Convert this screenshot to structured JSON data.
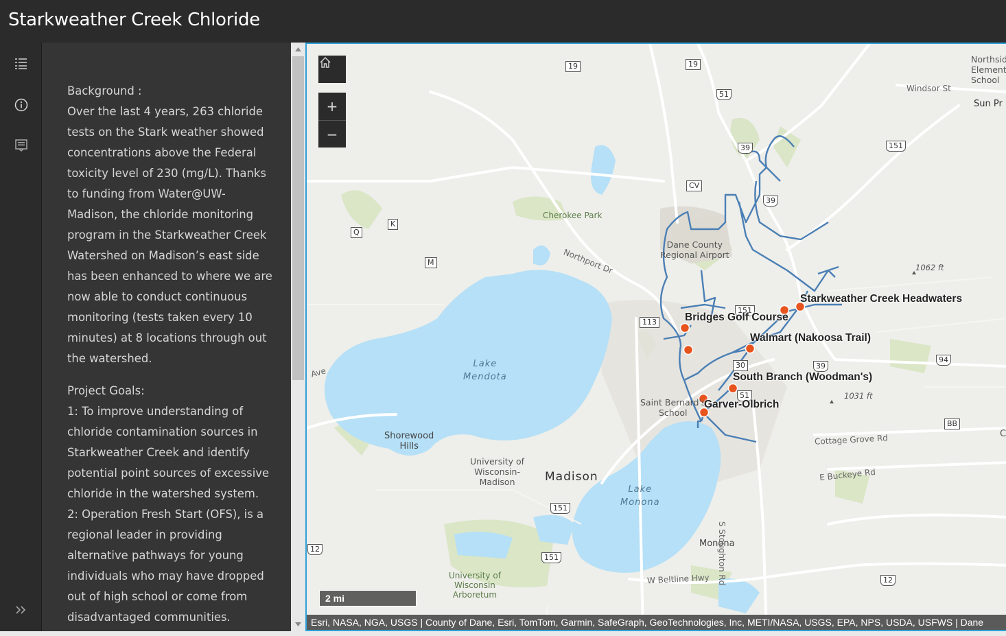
{
  "app": {
    "title": "Starkweather Creek Chloride"
  },
  "rail": {
    "items": [
      {
        "icon": "list-icon",
        "label": "Layer list"
      },
      {
        "icon": "info-icon",
        "label": "About"
      },
      {
        "icon": "legend-icon",
        "label": "Legend"
      }
    ],
    "expand_icon": "expand-icon"
  },
  "panel": {
    "background_heading": "Background :",
    "background_text": "Over the last 4 years, 263 chloride tests on the Stark weather showed concentrations above the Federal toxicity level of 230 (mg/L). Thanks to funding from Water@UW-Madison, the chloride monitoring program in the Starkweather Creek Watershed on Madison’s east side has been enhanced to where we are now able to conduct continuous monitoring (tests taken every 10 minutes) at 8 locations through out the watershed.",
    "goals_heading": "Project Goals:",
    "goal_1": "1: To improve understanding of chloride contamination sources in Starkweather Creek and identify potential point sources of excessive chloride in the watershed system.",
    "goal_2": "2: Operation Fresh Start (OFS), is a regional leader in providing alternative pathways for young individuals who may have dropped out of high school or come from disadvantaged communities."
  },
  "map": {
    "controls": {
      "home_icon": "home-icon",
      "zoom_in": "+",
      "zoom_out": "−"
    },
    "scalebar": "2 mi",
    "attribution": "Esri, NASA, NGA, USGS | County of Dane, Esri, TomTom, Garmin, SafeGraph, GeoTechnologies, Inc, METI/NASA, USGS, EPA, NPS, USDA, USFWS | Dane",
    "sites": [
      {
        "name": "Starkweather Creek Headwaters"
      },
      {
        "name": "Bridges Golf Course"
      },
      {
        "name": "Walmart (Nakoosa Trail)"
      },
      {
        "name": "South Branch (Woodman's)"
      },
      {
        "name": "Garver-Olbrich"
      }
    ],
    "water_labels": [
      {
        "line1": "Lake",
        "line2": "Mendota"
      },
      {
        "line1": "Lake",
        "line2": "Monona"
      }
    ],
    "places": {
      "madison": "Madison",
      "monona": "Monona",
      "shorewood_1": "Shorewood",
      "shorewood_2": "Hills",
      "uw_1": "University of",
      "uw_2": "Wisconsin-",
      "uw_3": "Madison",
      "airport_1": "Dane County",
      "airport_2": "Regional Airport",
      "saint_1": "Saint Bernard's",
      "saint_2": "School",
      "northside_1": "Northsid",
      "northside_2": "Elementa",
      "northside_3": "School",
      "sun_prairie": "Sun Pr",
      "elev_1": "1062 ft",
      "elev_2": "1031 ft",
      "c_label": "C"
    },
    "parks": {
      "cherokee": "Cherokee Park",
      "arb_1": "University of",
      "arb_2": "Wisconsin",
      "arb_3": "Arboretum"
    },
    "roads": {
      "northport": "Northport Dr",
      "windsor": "Windsor St",
      "cottage": "Cottage Grove Rd",
      "buckeye": "E Buckeye Rd",
      "stoughton": "S Stoughton Rd",
      "beltline": "W Beltline Hwy",
      "ave": "Ave"
    },
    "shields": [
      "19",
      "19",
      "51",
      "39",
      "151",
      "CV",
      "39",
      "Q",
      "K",
      "M",
      "151",
      "113",
      "30",
      "39",
      "94",
      "51",
      "BB",
      "151",
      "151",
      "12",
      "12"
    ]
  },
  "colors": {
    "header_bg": "#2b2b2b",
    "panel_bg": "#353535",
    "water": "#b5e0f7",
    "stream": "#4a7fb5",
    "site_marker": "#e8541e",
    "map_border": "#2e9fd8"
  }
}
